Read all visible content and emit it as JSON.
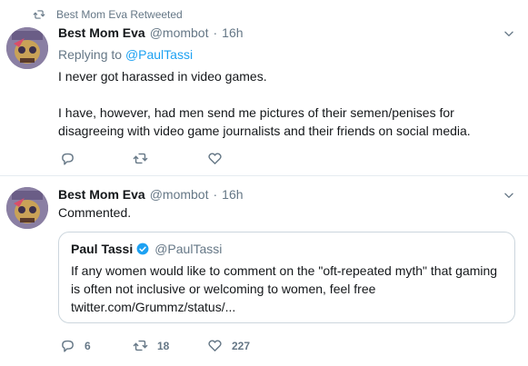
{
  "tweet1": {
    "retweet_text": "Best Mom Eva Retweeted",
    "author_name": "Best Mom Eva",
    "author_handle": "@mombot",
    "separator": "·",
    "time": "16h",
    "replying_prefix": "Replying to",
    "replying_to": "@PaulTassi",
    "text_line1": "I never got harassed in video games.",
    "text_line2": "I have, however, had men send me pictures of their semen/penises for",
    "text_line3": "disagreeing with video game journalists and their friends on social media."
  },
  "tweet2": {
    "author_name": "Best Mom Eva",
    "author_handle": "@mombot",
    "separator": "·",
    "time": "16h",
    "text": "Commented.",
    "quote": {
      "author_name": "Paul Tassi",
      "author_handle": "@PaulTassi",
      "line1": "If any women would like to comment on the \"oft-repeated myth\" that gaming",
      "line2": "is often not inclusive or welcoming to women, feel free",
      "line3": "twitter.com/Grummz/status/..."
    },
    "reply_count": "6",
    "retweet_count": "18",
    "like_count": "227"
  },
  "colors": {
    "link_blue": "#1da1f2",
    "muted_gray": "#657786",
    "text_dark": "#14171a",
    "border": "#e6ecf0"
  },
  "icons": [
    "retweet-icon",
    "caret-down-icon",
    "reply-icon",
    "like-icon",
    "verified-badge-icon"
  ]
}
